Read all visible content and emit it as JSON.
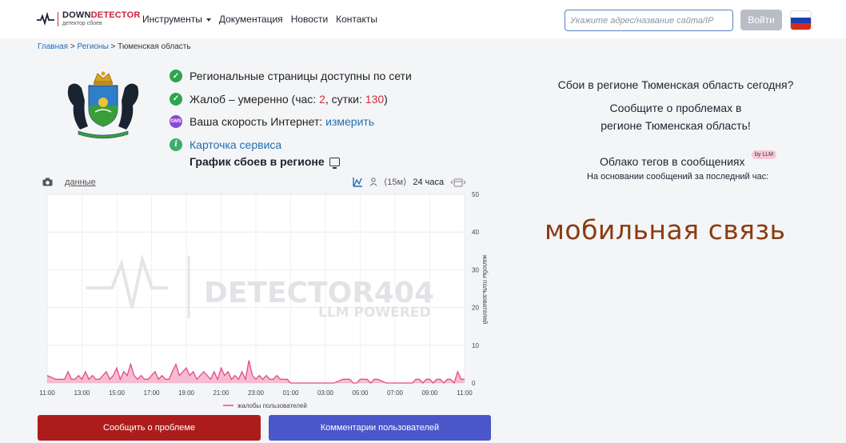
{
  "header": {
    "logo_main_a": "DOWN",
    "logo_main_b": "DETECTOR",
    "logo_sub": "детектор сбоев",
    "nav": [
      "Инструменты",
      "Документация",
      "Новости",
      "Контакты"
    ],
    "search_placeholder": "Укажите адрес/название сайта/IP",
    "login_label": "Войти",
    "flag_colors": [
      "#ffffff",
      "#1c3fae",
      "#d52b1e"
    ]
  },
  "breadcrumb": {
    "home": "Главная",
    "regions": "Регионы",
    "current": "Тюменская область",
    "sep": ">"
  },
  "status": {
    "row1": "Региональные страницы доступны по сети",
    "row2_prefix": "Жалоб – умеренно (час: ",
    "row2_hour": "2",
    "row2_mid": ", сутки: ",
    "row2_day": "130",
    "row2_suffix": ")",
    "row3_prefix": "Ваша скорость Интернет: ",
    "row3_link": "измерить",
    "row3_icon_text": "GMS",
    "row4_link": "Карточка сервиса",
    "graph_title": "График сбоев в регионе"
  },
  "chart_toolbar": {
    "data_link": "данные",
    "interval": "⟨15м⟩",
    "period": "24 часа"
  },
  "chart_data": {
    "type": "area",
    "watermark_main": "DETECTOR404",
    "watermark_sub": "LLM POWERED",
    "ylabel": "жалобы пользователей",
    "legend": "жалобы пользователей",
    "ylim": [
      0,
      50
    ],
    "y_ticks": [
      "0",
      "10",
      "20",
      "30",
      "40",
      "50"
    ],
    "x_ticks": [
      "11:00",
      "13:00",
      "15:00",
      "17:00",
      "19:00",
      "21:00",
      "23:00",
      "01:00",
      "03:00",
      "05:00",
      "07:00",
      "09:00",
      "11:00"
    ],
    "x_hours": [
      0,
      0.5,
      1,
      1.2,
      1.4,
      1.6,
      1.8,
      2,
      2.2,
      2.4,
      2.6,
      2.8,
      3,
      3.2,
      3.4,
      3.6,
      3.8,
      4,
      4.2,
      4.4,
      4.6,
      4.8,
      5,
      5.2,
      5.4,
      5.6,
      5.8,
      6,
      6.2,
      6.4,
      6.6,
      6.8,
      7,
      7.2,
      7.4,
      7.6,
      7.8,
      8,
      8.2,
      8.4,
      8.6,
      8.8,
      9,
      9.2,
      9.4,
      9.6,
      9.8,
      10,
      10.2,
      10.4,
      10.6,
      10.8,
      11,
      11.2,
      11.4,
      11.6,
      11.8,
      12,
      12.2,
      12.4,
      12.6,
      12.8,
      13,
      13.2,
      13.4,
      13.6,
      13.8,
      14,
      14.5,
      15,
      15.5,
      16,
      16.5,
      17,
      17.2,
      17.4,
      17.6,
      17.8,
      18,
      18.2,
      18.4,
      18.6,
      18.8,
      19,
      19.5,
      20,
      20.5,
      21,
      21.2,
      21.4,
      21.6,
      21.8,
      22,
      22.2,
      22.4,
      22.6,
      22.8,
      23,
      23.2,
      23.4,
      23.6,
      23.8,
      24
    ],
    "values": [
      2,
      1,
      1,
      3,
      1,
      1,
      2,
      1,
      3,
      1,
      2,
      1,
      1,
      2,
      3,
      1,
      2,
      4,
      1,
      3,
      2,
      5,
      2,
      1,
      2,
      1,
      1,
      2,
      3,
      1,
      2,
      1,
      1,
      3,
      5,
      2,
      3,
      4,
      2,
      3,
      1,
      2,
      3,
      2,
      1,
      3,
      1,
      4,
      2,
      3,
      1,
      2,
      1,
      3,
      1,
      6,
      2,
      1,
      2,
      1,
      2,
      1,
      1,
      2,
      1,
      1,
      1,
      0,
      0,
      0,
      0,
      0,
      0,
      1,
      1,
      1,
      0,
      0,
      1,
      1,
      1,
      0,
      1,
      1,
      0,
      0,
      0,
      0,
      1,
      1,
      0,
      1,
      1,
      0,
      1,
      1,
      0,
      1,
      1,
      0,
      3,
      1,
      1,
      0
    ],
    "color": "#e34c87"
  },
  "buttons": {
    "report": "Сообщить о проблеме",
    "comments": "Комментарии пользователей"
  },
  "right": {
    "question": "Сбои в регионе Тюменская область сегодня?",
    "report_line1": "Сообщите о проблемах в",
    "report_line2": "регионе Тюменская область!",
    "cloud_title": "Облако тегов в сообщениях",
    "llm_badge": "by LLM",
    "cloud_sub": "На основании сообщений за последний час:",
    "tag": "мобильная связь"
  }
}
